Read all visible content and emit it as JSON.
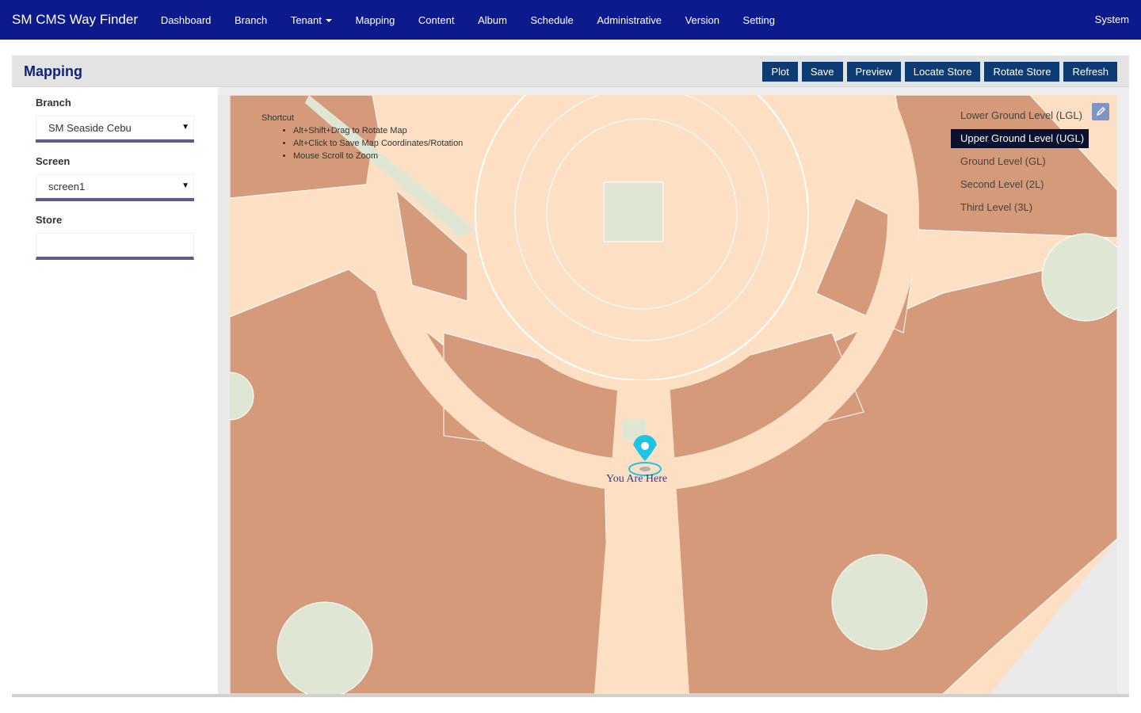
{
  "nav": {
    "brand": "SM CMS Way Finder",
    "items": [
      "Dashboard",
      "Branch",
      "Tenant",
      "Mapping",
      "Content",
      "Album",
      "Schedule",
      "Administrative",
      "Version",
      "Setting"
    ],
    "right": "System"
  },
  "page": {
    "title": "Mapping",
    "buttons": [
      "Plot",
      "Save",
      "Preview",
      "Locate Store",
      "Rotate Store",
      "Refresh"
    ]
  },
  "side": {
    "branch_label": "Branch",
    "branch_value": "SM Seaside Cebu",
    "screen_label": "Screen",
    "screen_value": "screen1",
    "store_label": "Store",
    "store_value": ""
  },
  "map": {
    "shortcut_title": "Shortcut",
    "shortcuts": [
      "Alt+Shift+Drag to Rotate Map",
      "Alt+Click to Save Map Coordinates/Rotation",
      "Mouse Scroll to Zoom"
    ],
    "you_are_here": "You Are Here",
    "levels": [
      "Lower Ground Level (LGL)",
      "Upper Ground Level (UGL)",
      "Ground Level (GL)",
      "Second Level (2L)",
      "Third Level (3L)"
    ],
    "active_level": "Upper Ground Level (UGL)",
    "colors": {
      "floor": "#fde0c4",
      "store": "#d49a7a",
      "green": "#dfe7d4",
      "pin": "#1fc3e4"
    }
  }
}
